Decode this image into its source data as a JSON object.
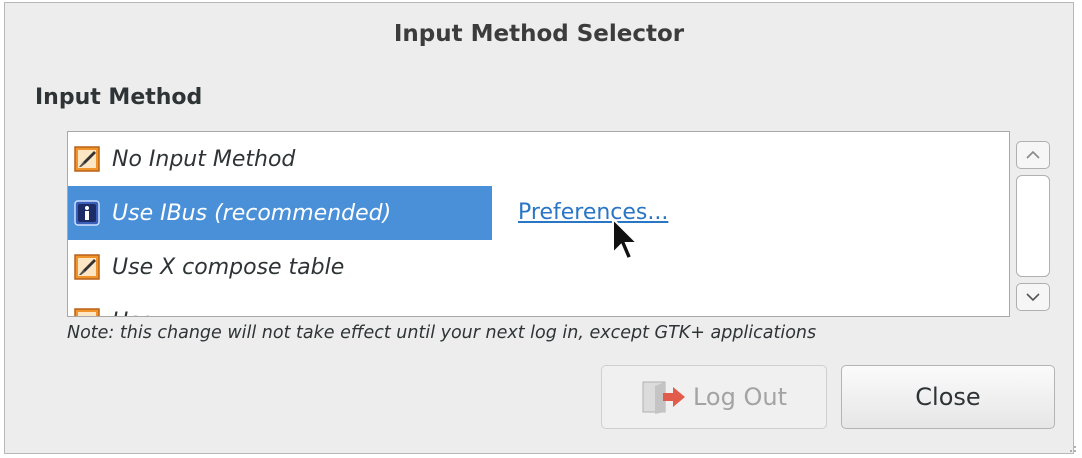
{
  "window": {
    "title": "Input Method Selector"
  },
  "section": {
    "label": "Input Method"
  },
  "methods": [
    {
      "label": "No Input Method",
      "icon": "brush-icon",
      "selected": false
    },
    {
      "label": "Use IBus (recommended)",
      "icon": "info-icon",
      "selected": true
    },
    {
      "label": "Use X compose table",
      "icon": "brush-icon",
      "selected": false
    },
    {
      "label": "Use ...",
      "icon": "brush-icon",
      "selected": false
    }
  ],
  "preferences_link": "Preferences...",
  "note": "Note: this change will not take effect until your next log in, except GTK+ applications",
  "buttons": {
    "logout": {
      "label": "Log Out",
      "enabled": false
    },
    "close": {
      "label": "Close"
    }
  },
  "colors": {
    "selection": "#4a90d9",
    "link": "#2a76c6",
    "icon_orange": "#f0932b"
  }
}
